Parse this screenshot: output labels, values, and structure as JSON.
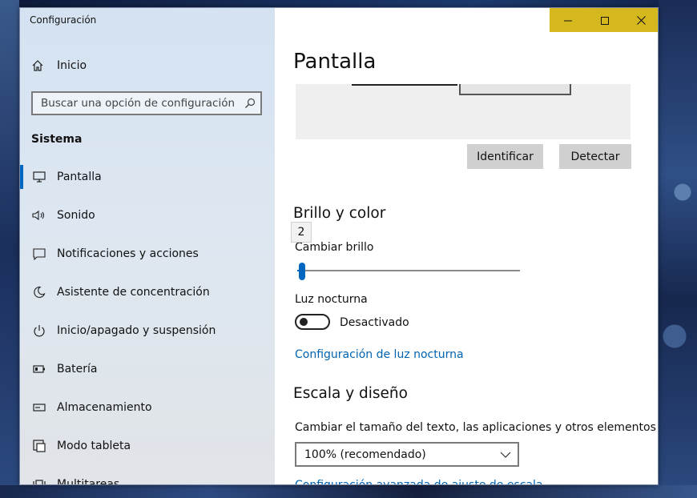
{
  "window": {
    "title": "Configuración"
  },
  "colors": {
    "accent": "#0067c0",
    "caption_bar": "#d5b81d",
    "link": "#0063b1"
  },
  "sidebar": {
    "home": {
      "label": "Inicio",
      "icon": "home-icon"
    },
    "search": {
      "placeholder": "Buscar una opción de configuración",
      "icon": "search-icon"
    },
    "section": "Sistema",
    "items": [
      {
        "label": "Pantalla",
        "icon": "monitor-icon",
        "active": true
      },
      {
        "label": "Sonido",
        "icon": "speaker-icon"
      },
      {
        "label": "Notificaciones y acciones",
        "icon": "notification-icon"
      },
      {
        "label": "Asistente de concentración",
        "icon": "moon-icon"
      },
      {
        "label": "Inicio/apagado y suspensión",
        "icon": "power-icon"
      },
      {
        "label": "Batería",
        "icon": "battery-icon"
      },
      {
        "label": "Almacenamiento",
        "icon": "storage-icon"
      },
      {
        "label": "Modo tableta",
        "icon": "tablet-icon"
      },
      {
        "label": "Multitareas",
        "icon": "multitask-icon"
      }
    ]
  },
  "main": {
    "title": "Pantalla",
    "identify_label": "Identificar",
    "detect_label": "Detectar",
    "brightness": {
      "heading": "Brillo y color",
      "tooltip_value": "2",
      "label": "Cambiar brillo",
      "value_percent": 2
    },
    "night_light": {
      "label": "Luz nocturna",
      "state_label": "Desactivado",
      "settings_link": "Configuración de luz nocturna"
    },
    "scale": {
      "heading": "Escala y diseño",
      "label": "Cambiar el tamaño del texto, las aplicaciones y otros elementos",
      "selected": "100% (recomendado)",
      "advanced_link": "Configuración avanzada de ajuste de escala"
    }
  }
}
